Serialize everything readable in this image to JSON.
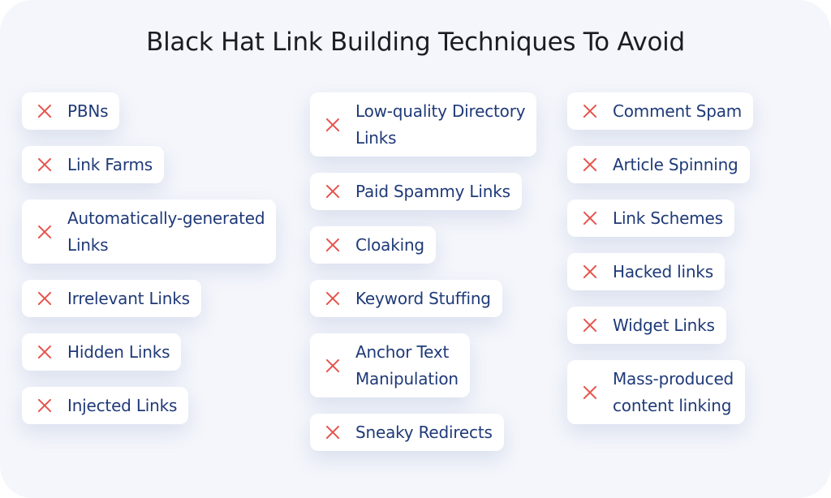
{
  "title": "Black Hat Link Building Techniques To Avoid",
  "colors": {
    "accent_x": "#e5534b",
    "text": "#1f3a78",
    "title": "#1b1d23",
    "background": "#f4f6fb"
  },
  "icon": "close-x-icon",
  "columns": [
    {
      "items": [
        {
          "label": "PBNs"
        },
        {
          "label": "Link Farms"
        },
        {
          "label": "Automatically-generated\nLinks"
        },
        {
          "label": "Irrelevant Links"
        },
        {
          "label": "Hidden Links"
        },
        {
          "label": "Injected Links"
        }
      ]
    },
    {
      "items": [
        {
          "label": "Low-quality Directory\nLinks"
        },
        {
          "label": "Paid Spammy Links"
        },
        {
          "label": "Cloaking"
        },
        {
          "label": "Keyword Stuffing"
        },
        {
          "label": "Anchor Text\nManipulation"
        },
        {
          "label": "Sneaky Redirects"
        }
      ]
    },
    {
      "items": [
        {
          "label": "Comment Spam"
        },
        {
          "label": "Article Spinning"
        },
        {
          "label": "Link Schemes"
        },
        {
          "label": "Hacked links"
        },
        {
          "label": "Widget Links"
        },
        {
          "label": "Mass-produced\ncontent linking"
        }
      ]
    }
  ]
}
